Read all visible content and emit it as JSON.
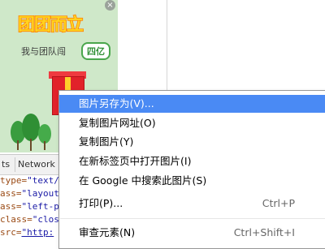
{
  "ad": {
    "title": "团团而立",
    "subtitle": "我与团队闯",
    "badge": "四亿",
    "close_glyph": "×"
  },
  "devtools": {
    "tabs": [
      {
        "label": "ts"
      },
      {
        "label": "Network"
      }
    ],
    "code_lines": [
      {
        "attr": "type=",
        "value": "\"text/"
      },
      {
        "attr": "ass=",
        "value": "\"layout"
      },
      {
        "attr": "ass=",
        "value": "\"left-p"
      },
      {
        "attr": "class=",
        "value": "\"clos"
      },
      {
        "attr": "src=",
        "value": "\"http:"
      }
    ]
  },
  "context_menu": {
    "items": [
      {
        "label": "图片另存为(V)...",
        "shortcut": ""
      },
      {
        "label": "复制图片网址(O)",
        "shortcut": ""
      },
      {
        "label": "复制图片(Y)",
        "shortcut": ""
      },
      {
        "label": "在新标签页中打开图片(I)",
        "shortcut": ""
      },
      {
        "label": "在 Google 中搜索此图片(S)",
        "shortcut": ""
      },
      {
        "label": "打印(P)...",
        "shortcut": "Ctrl+P"
      },
      {
        "label": "审查元素(N)",
        "shortcut": "Ctrl+Shift+I"
      }
    ]
  },
  "colors": {
    "menu_highlight": "#4a8af4",
    "ad_background": "#cfe8c9",
    "ad_title": "#ffd21f"
  }
}
